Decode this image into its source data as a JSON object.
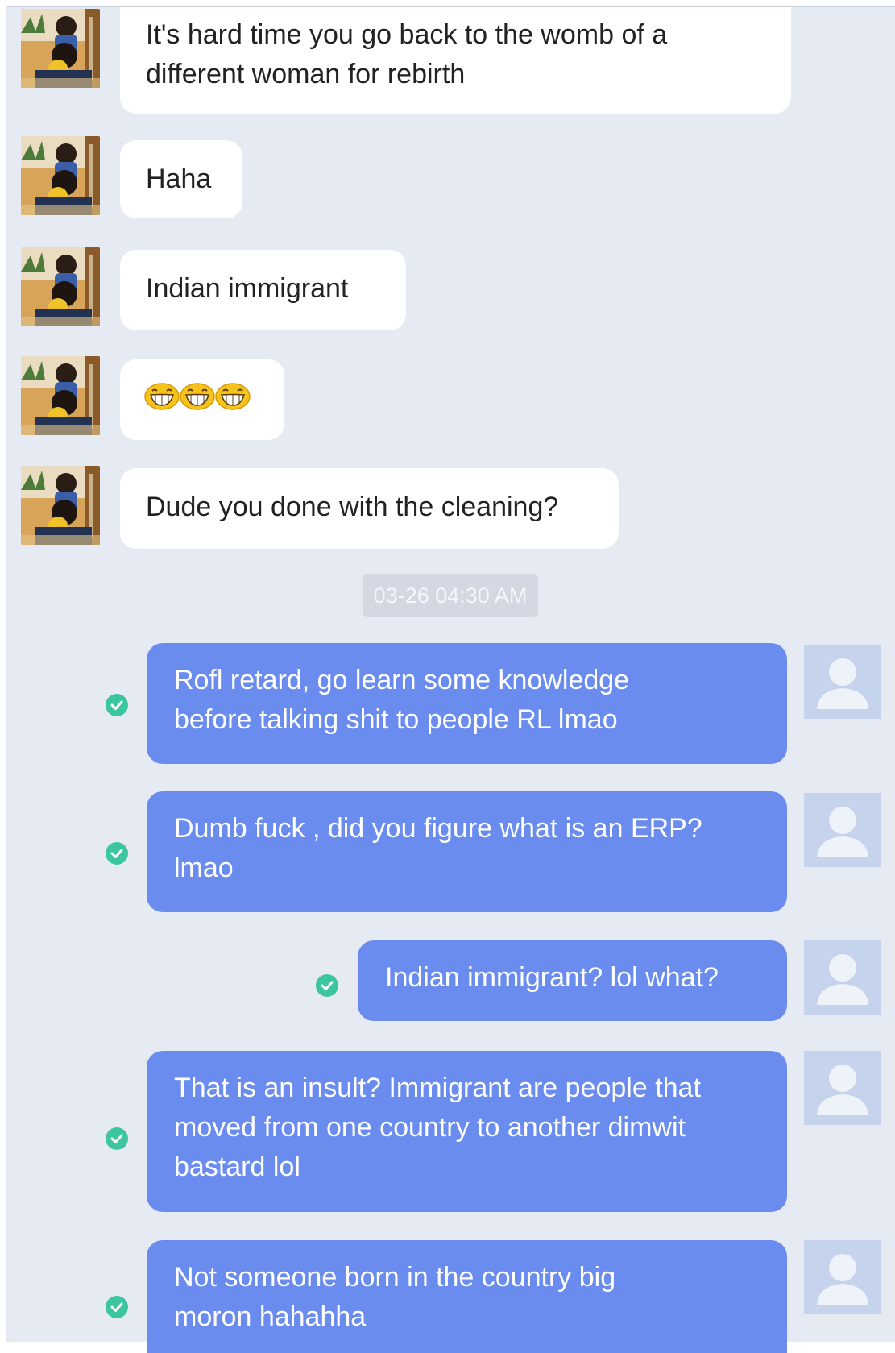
{
  "conversation": {
    "incoming": [
      {
        "text": "It's hard time you go back to the womb of a\ndifferent woman for rebirth"
      },
      {
        "text": "Haha"
      },
      {
        "text": "Indian immigrant"
      },
      {
        "emoji": [
          "grin-emoji",
          "grin-emoji",
          "grin-emoji"
        ]
      },
      {
        "text": "Dude you done with the cleaning?"
      }
    ],
    "timestamp": "03-26 04:30 AM",
    "outgoing": [
      {
        "text": "Rofl retard, go learn some knowledge\nbefore talking shit to people RL lmao"
      },
      {
        "text": "Dumb fuck , did you figure what is an ERP?\nlmao"
      },
      {
        "text": "Indian immigrant? lol what?"
      },
      {
        "text": "That is an insult? Immigrant are people that\nmoved from one country to another dimwit\nbastard lol"
      },
      {
        "text": "Not someone born in  the country big\nmoron hahahha"
      }
    ]
  },
  "colors": {
    "background": "#e6eaf2",
    "incoming_bubble": "#ffffff",
    "outgoing_bubble": "#6b8cef",
    "sent_check": "#3cc6a0"
  },
  "icons": {
    "contact_avatar": "contact-avatar-photo",
    "my_avatar": "default-user-icon",
    "status": "check-circle-icon"
  }
}
